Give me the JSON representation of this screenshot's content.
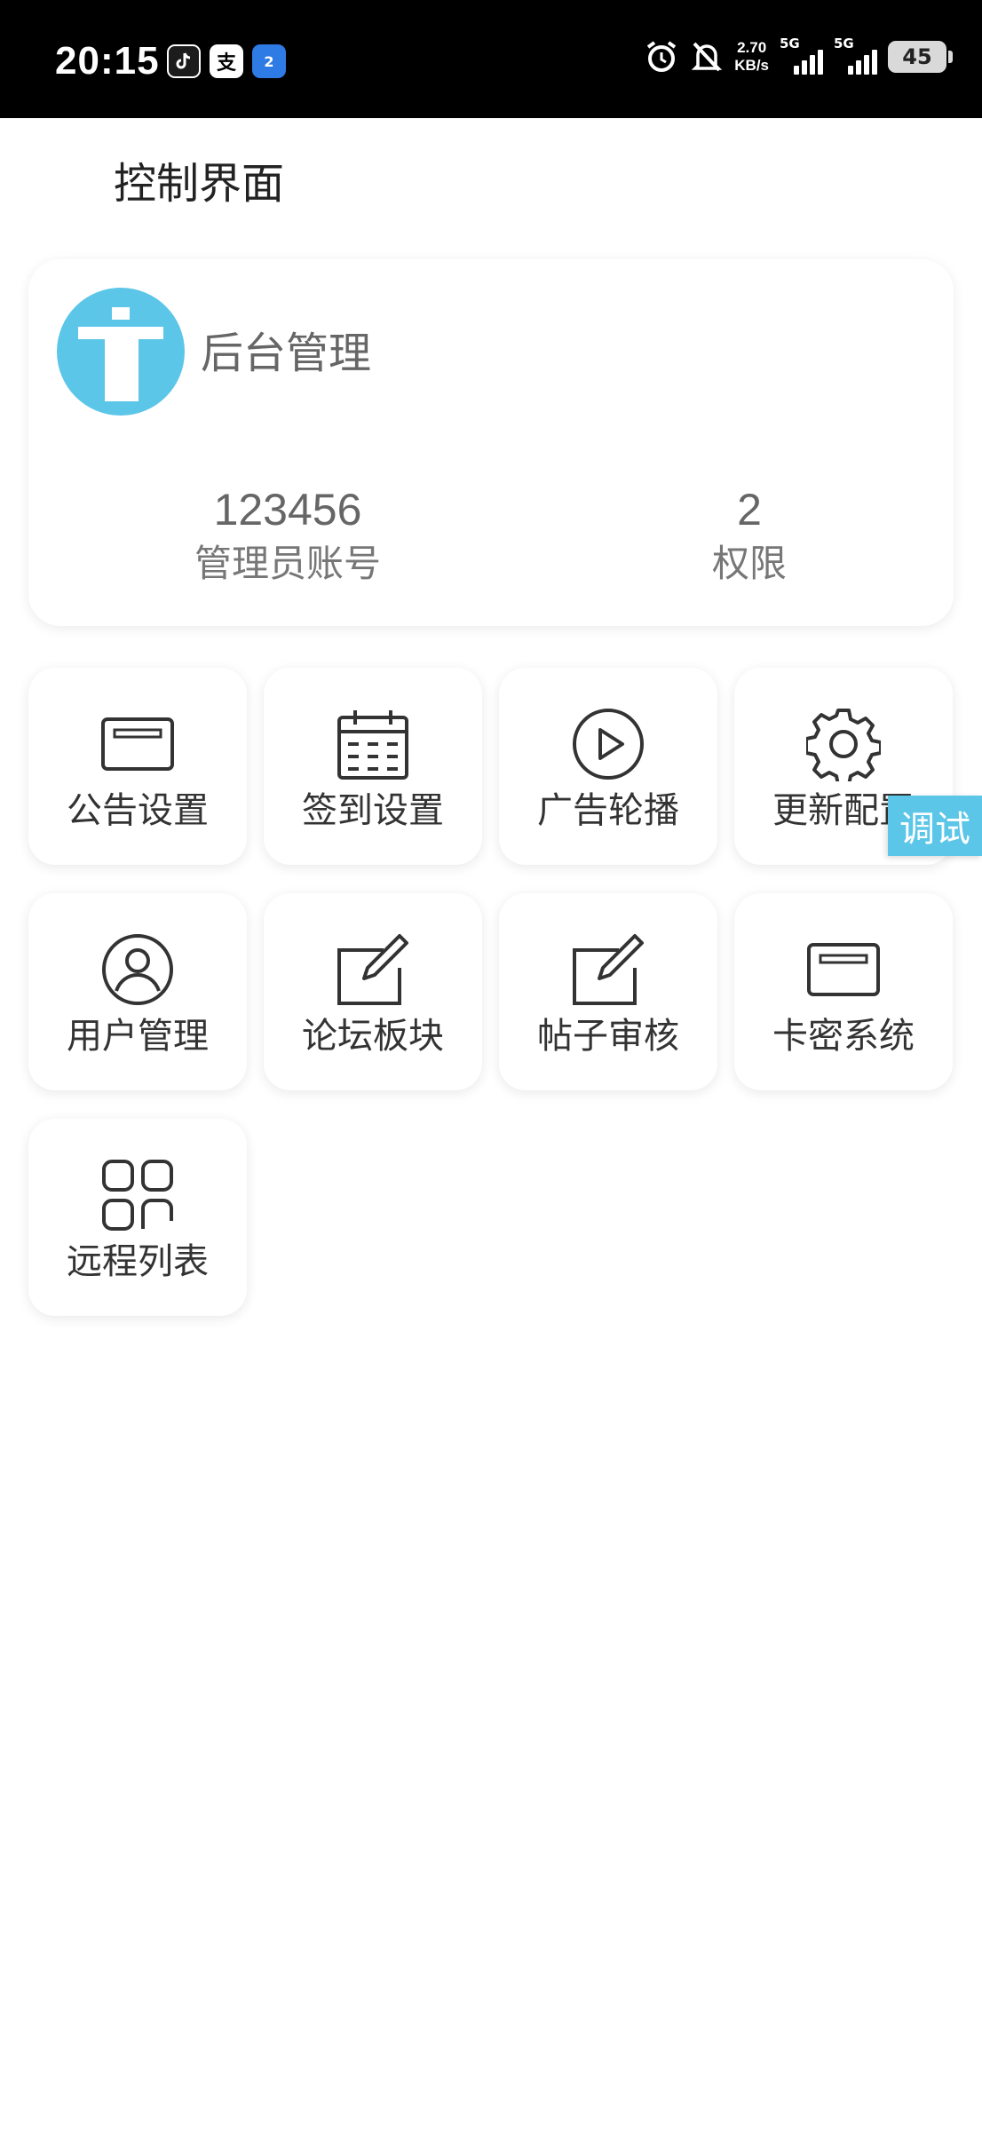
{
  "status_bar": {
    "time": "20:15",
    "net_speed_value": "2.70",
    "net_speed_unit": "KB/s",
    "signal_1_label": "5G",
    "signal_2_label": "5G",
    "battery": "45",
    "app_icons": [
      "douyin-icon",
      "zhi-icon",
      "nfc-icon"
    ],
    "app_icon_labels": {
      "zhi": "支",
      "nfc": "2"
    }
  },
  "page": {
    "title": "控制界面"
  },
  "profile": {
    "name": "后台管理",
    "avatar_color": "#5bc6e8",
    "stats": [
      {
        "value": "123456",
        "label": "管理员账号"
      },
      {
        "value": "2",
        "label": "权限"
      }
    ]
  },
  "menu": [
    {
      "label": "公告设置",
      "icon": "card-icon"
    },
    {
      "label": "签到设置",
      "icon": "calendar-icon"
    },
    {
      "label": "广告轮播",
      "icon": "play-icon"
    },
    {
      "label": "更新配置",
      "icon": "gear-icon"
    },
    {
      "label": "用户管理",
      "icon": "user-icon"
    },
    {
      "label": "论坛板块",
      "icon": "edit-icon"
    },
    {
      "label": "帖子审核",
      "icon": "edit-icon"
    },
    {
      "label": "卡密系统",
      "icon": "card-icon"
    },
    {
      "label": "远程列表",
      "icon": "grid-icon"
    }
  ],
  "debug_button": {
    "label": "调试",
    "color": "#5bc6e8"
  }
}
